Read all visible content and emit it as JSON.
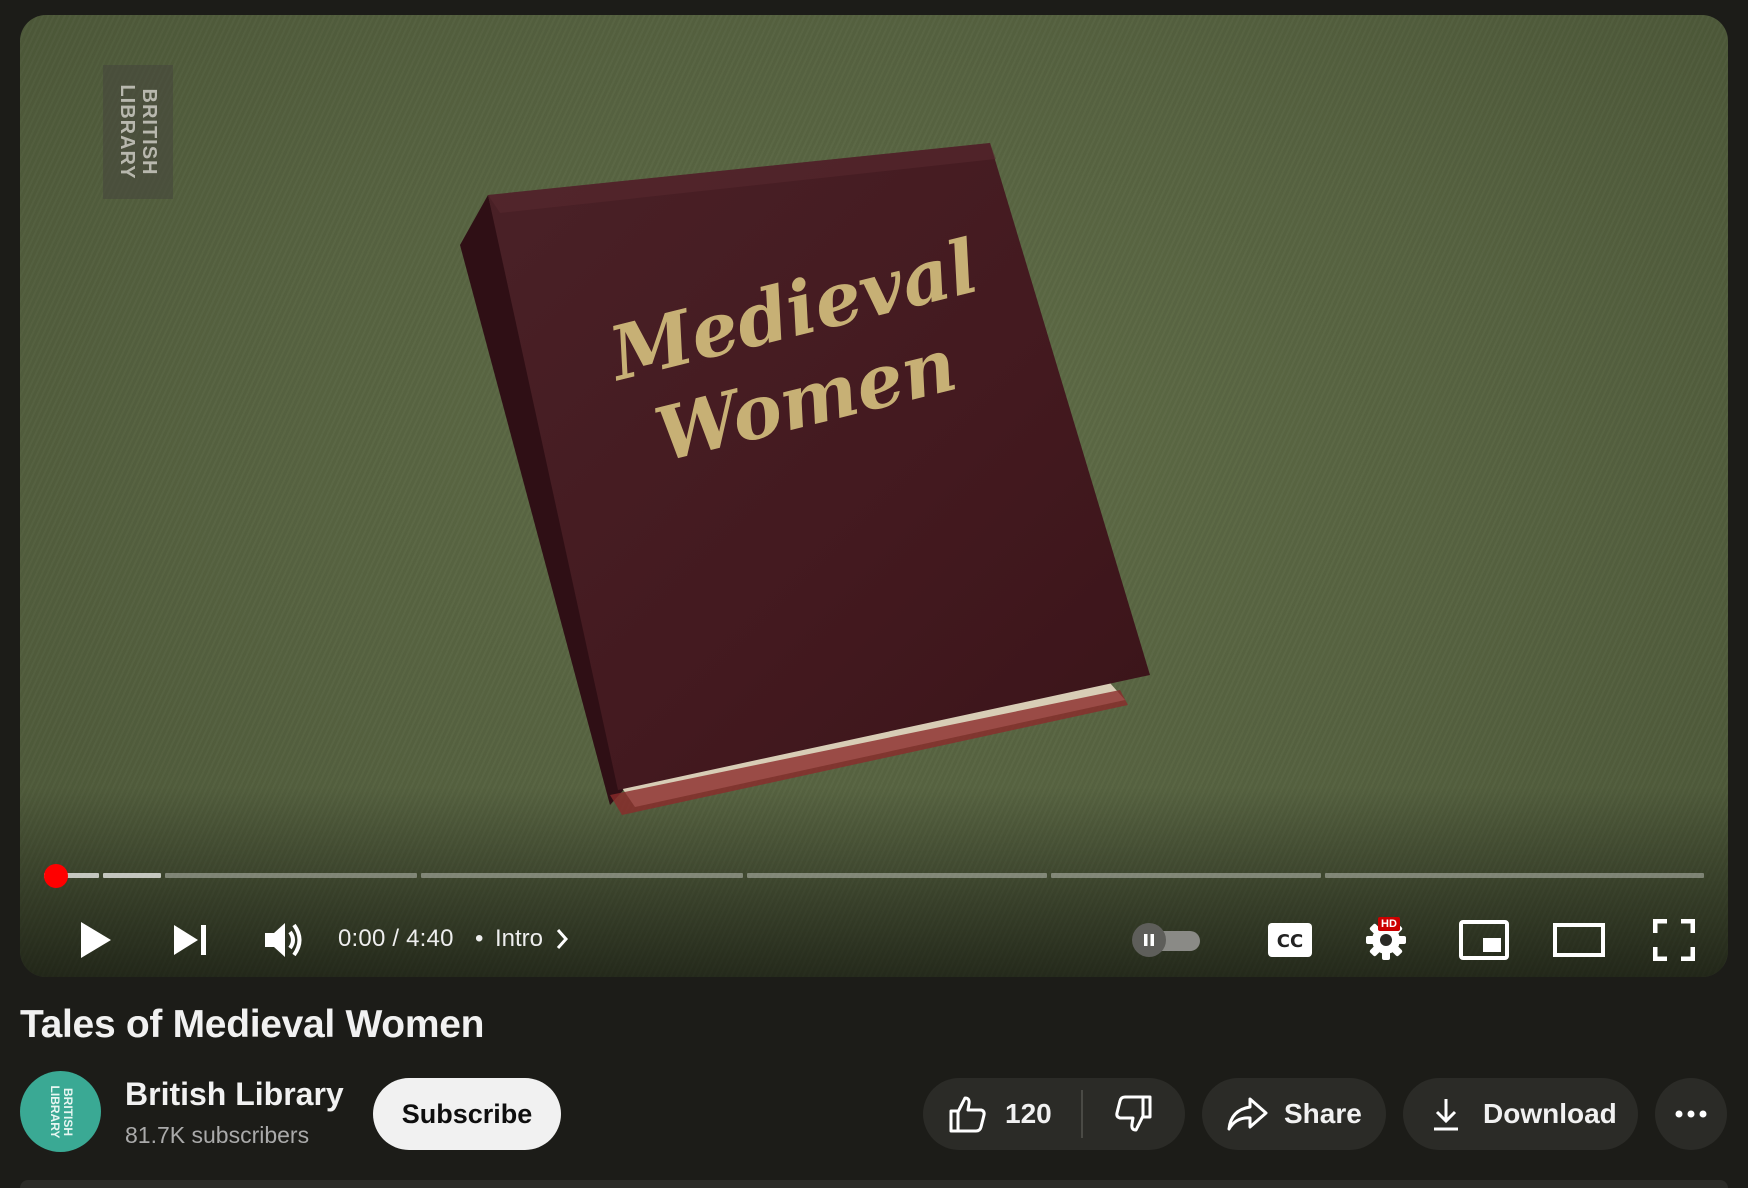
{
  "player": {
    "watermark": "BRITISH\nLIBRARY",
    "book_title_line1": "Medieval",
    "book_title_line2": "Women",
    "progress_fraction": 0.0,
    "time_display": "0:00 / 4:40",
    "separator": "•",
    "chapter": "Intro",
    "hd_badge": "HD",
    "icons": [
      "play-icon",
      "next-icon",
      "volume-icon",
      "chevron-right-icon",
      "autoplay-toggle-icon",
      "cc-icon",
      "settings-icon",
      "miniplayer-icon",
      "theater-icon",
      "fullscreen-icon"
    ]
  },
  "video": {
    "title": "Tales of Medieval Women"
  },
  "channel": {
    "avatar_text": "BRITISH\nLIBRARY",
    "name": "British Library",
    "subscribers": "81.7K subscribers",
    "subscribe_label": "Subscribe"
  },
  "actions": {
    "like_count": "120",
    "share_label": "Share",
    "download_label": "Download",
    "more_label": "More actions"
  },
  "colors": {
    "accent": "#ff0000",
    "background": "#1c1c18",
    "pill": "#2b2b27"
  }
}
